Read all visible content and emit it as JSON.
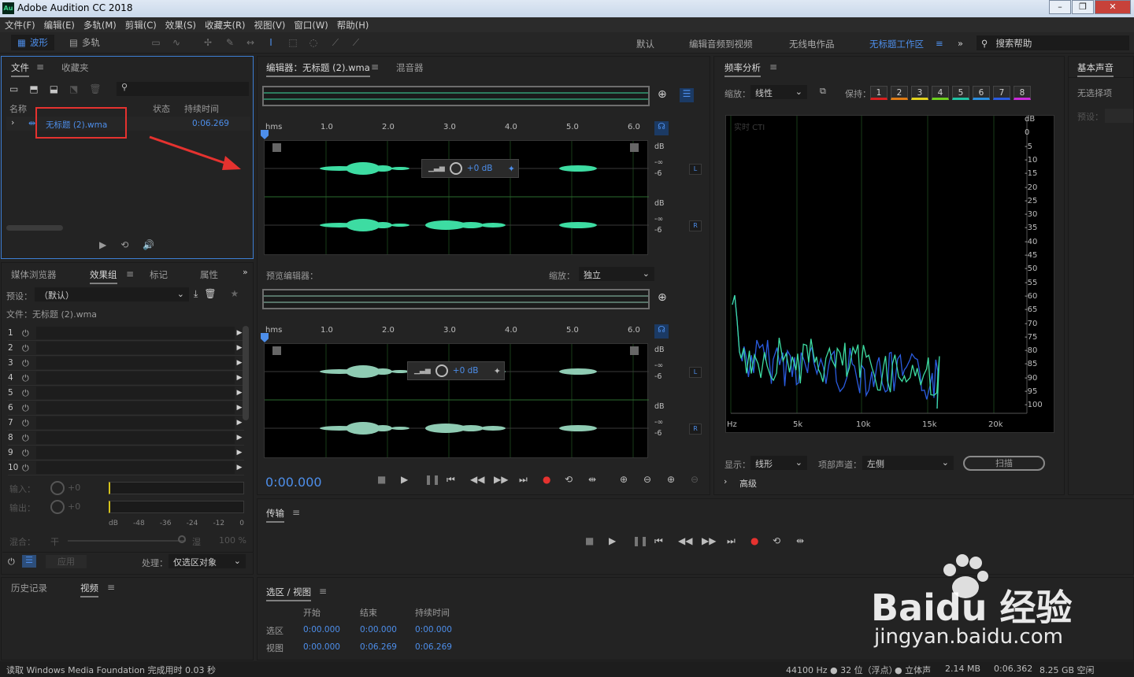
{
  "window": {
    "title": "Adobe Audition CC 2018",
    "app_badge": "Au"
  },
  "menu": [
    "文件(F)",
    "编辑(E)",
    "多轨(M)",
    "剪辑(C)",
    "效果(S)",
    "收藏夹(R)",
    "视图(V)",
    "窗口(W)",
    "帮助(H)"
  ],
  "toolbar": {
    "modes": [
      "波形",
      "多轨"
    ],
    "workspaces": [
      "默认",
      "编辑音频到视频",
      "无线电作品",
      "无标题工作区"
    ],
    "search_placeholder": "搜索帮助"
  },
  "files_panel": {
    "tabs": [
      "文件",
      "收藏夹"
    ],
    "columns": [
      "名称",
      "状态",
      "持续时间"
    ],
    "file": {
      "name": "无标题 (2).wma",
      "duration": "0:06.269"
    }
  },
  "editor": {
    "tabs": [
      "编辑器：无标题 (2).wma",
      "混音器"
    ],
    "ruler": [
      "hms",
      "1.0",
      "2.0",
      "3.0",
      "4.0",
      "5.0",
      "6.0"
    ],
    "db_labels": [
      "dB",
      "-∞",
      "-6"
    ],
    "channels": [
      "L",
      "R"
    ],
    "volume": "+0 dB"
  },
  "preview_editor": {
    "title": "预览编辑器：",
    "zoom_label": "缩放：",
    "zoom_value": "独立"
  },
  "effects_panel": {
    "tabs": [
      "媒体浏览器",
      "效果组",
      "标记",
      "属性"
    ],
    "preset_label": "预设：",
    "preset_value": "（默认）",
    "file_label": "文件：无标题 (2).wma",
    "slots": [
      "1",
      "2",
      "3",
      "4",
      "5",
      "6",
      "7",
      "8",
      "9",
      "10"
    ],
    "input_label": "输入：",
    "output_label": "输出：",
    "gain": "+0",
    "meter_scale": [
      "dB",
      "-48",
      "-36",
      "-24",
      "-12",
      "0"
    ],
    "mix_label": "混合：",
    "mix_dry": "干",
    "mix_wet": "湿",
    "mix_pct": "100 %",
    "apply": "应用",
    "process_label": "处理：",
    "process_value": "仅选区对象"
  },
  "time": {
    "current": "0:00.000"
  },
  "history_panel": {
    "tabs": [
      "历史记录",
      "视频"
    ]
  },
  "transport_panel": {
    "title": "传输"
  },
  "selection_panel": {
    "title": "选区 / 视图",
    "cols": [
      "开始",
      "结束",
      "持续时间"
    ],
    "rows": [
      {
        "label": "选区",
        "start": "0:00.000",
        "end": "0:00.000",
        "dur": "0:00.000"
      },
      {
        "label": "视图",
        "start": "0:00.000",
        "end": "0:06.269",
        "dur": "0:06.269"
      }
    ]
  },
  "freq_panel": {
    "title": "频率分析",
    "scale_label": "缩放：",
    "scale_value": "线性",
    "hold_label": "保持：",
    "hold": [
      "1",
      "2",
      "3",
      "4",
      "5",
      "6",
      "7",
      "8"
    ],
    "hold_colors": [
      "#d81f1f",
      "#e07b14",
      "#e3d31d",
      "#6ed01e",
      "#1fc3a4",
      "#2a8fe0",
      "#2a5ce0",
      "#c92ad8"
    ],
    "realtime": "实时 CTI",
    "x_ticks": [
      "Hz",
      "5k",
      "10k",
      "15k",
      "20k"
    ],
    "y_ticks": [
      "dB",
      "0",
      "-5",
      "-10",
      "-15",
      "-20",
      "-25",
      "-30",
      "-35",
      "-40",
      "-45",
      "-50",
      "-55",
      "-60",
      "-65",
      "-70",
      "-75",
      "-80",
      "-85",
      "-90",
      "-95",
      "-100"
    ],
    "display_label": "显示：",
    "display_value": "线形",
    "channel_label": "项部声道：",
    "channel_value": "左侧",
    "scan": "扫描",
    "advanced": "高级"
  },
  "right_panel": {
    "title": "基本声音",
    "no_selection": "无选择项",
    "preset": "预设："
  },
  "status": {
    "left": "读取 Windows Media Foundation 完成用时 0.03 秒",
    "rate": "44100 Hz ● 32 位（浮点）",
    "channels": "● 立体声",
    "size": "2.14 MB",
    "duration": "0:06.362",
    "free": "8.25 GB 空闲"
  },
  "watermark": {
    "brand": "Baidu 经验",
    "url": "jingyan.baidu.com"
  }
}
